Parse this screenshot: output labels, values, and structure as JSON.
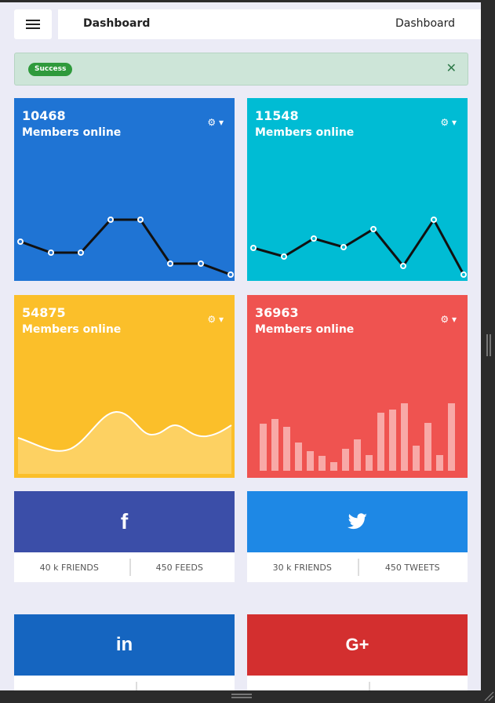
{
  "header": {
    "title": "Dashboard",
    "breadcrumb": "Dashboard",
    "menu_icon": "hamburger-icon"
  },
  "alert": {
    "badge": "Success",
    "close_icon": "close-icon"
  },
  "cards": [
    {
      "value": "10468",
      "label": "Members online",
      "color": "#1f74d4",
      "chart": "line",
      "points": [
        28,
        14,
        14,
        -28,
        -28,
        28,
        28,
        14
      ]
    },
    {
      "value": "11548",
      "label": "Members online",
      "color": "#00bcd4",
      "chart": "line"
    },
    {
      "value": "54875",
      "label": "Members online",
      "color": "#fbbf2a",
      "chart": "area"
    },
    {
      "value": "36963",
      "label": "Members online",
      "color": "#ef5350",
      "chart": "bar"
    }
  ],
  "social": [
    {
      "network": "facebook",
      "icon": "facebook-icon",
      "color": "#3b4ea8",
      "stat1": "40 k FRIENDS",
      "stat2": "450 FEEDS"
    },
    {
      "network": "twitter",
      "icon": "twitter-icon",
      "color": "#1e88e5",
      "stat1": "30 k FRIENDS",
      "stat2": "450 TWEETS"
    },
    {
      "network": "linkedin",
      "icon": "linkedin-icon",
      "color": "#1565c0",
      "stat1": "",
      "stat2": ""
    },
    {
      "network": "google-plus",
      "icon": "google-plus-icon",
      "color": "#d32f2f",
      "stat1": "",
      "stat2": ""
    }
  ]
}
